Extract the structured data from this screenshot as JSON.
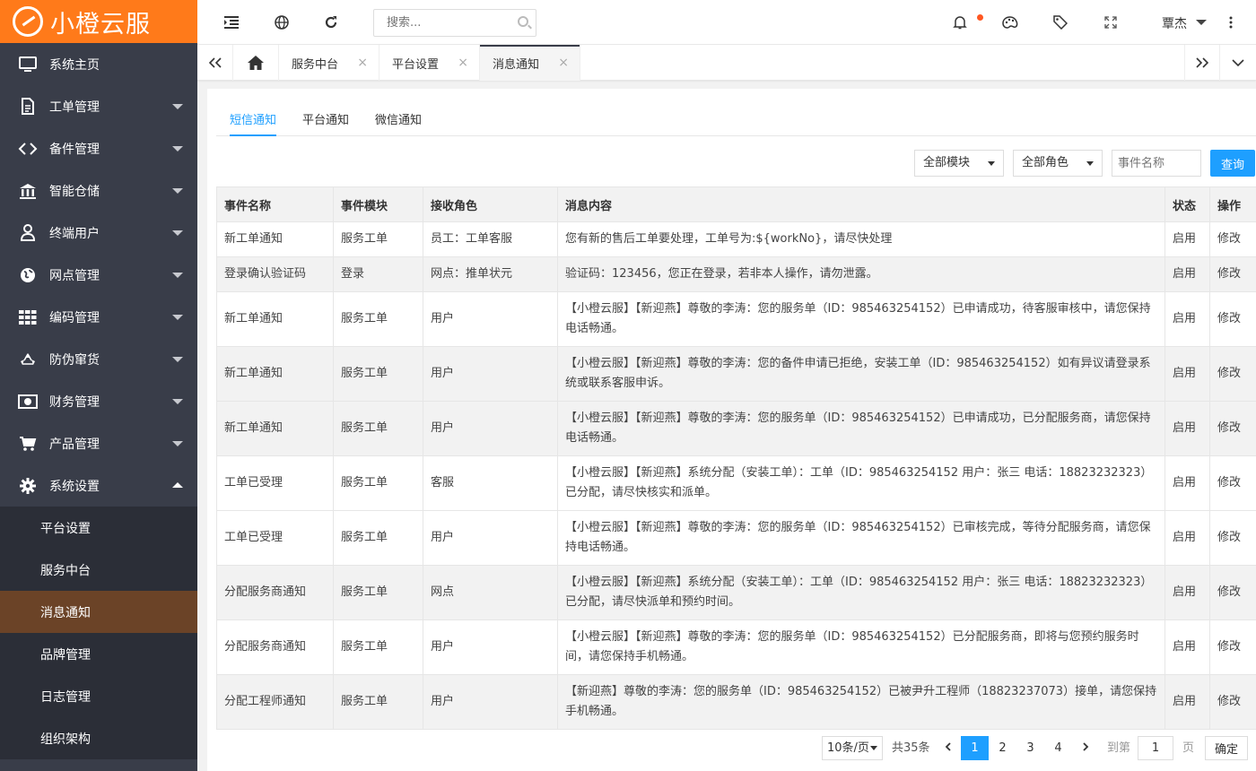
{
  "app": {
    "logo_text": "小橙云服"
  },
  "sidebar": {
    "items": [
      {
        "label": "系统主页",
        "icon": "monitor-icon"
      },
      {
        "label": "工单管理",
        "icon": "document-icon"
      },
      {
        "label": "备件管理",
        "icon": "link-icon"
      },
      {
        "label": "智能仓储",
        "icon": "warehouse-icon"
      },
      {
        "label": "终端用户",
        "icon": "user-icon"
      },
      {
        "label": "网点管理",
        "icon": "globe-icon"
      },
      {
        "label": "编码管理",
        "icon": "grid-icon"
      },
      {
        "label": "防伪窜货",
        "icon": "recycle-icon"
      },
      {
        "label": "财务管理",
        "icon": "money-icon"
      },
      {
        "label": "产品管理",
        "icon": "cart-icon"
      },
      {
        "label": "系统设置",
        "icon": "gear-icon"
      }
    ],
    "sub_items": [
      "平台设置",
      "服务中台",
      "消息通知",
      "品牌管理",
      "日志管理",
      "组织架构"
    ]
  },
  "topbar": {
    "search_placeholder": "搜索...",
    "user_name": "覃杰"
  },
  "tabs": {
    "items": [
      "服务中台",
      "平台设置",
      "消息通知"
    ],
    "close": "×"
  },
  "subtabs": [
    "短信通知",
    "平台通知",
    "微信通知"
  ],
  "filters": {
    "module": "全部模块",
    "role": "全部角色",
    "event_placeholder": "事件名称",
    "query_label": "查询"
  },
  "table": {
    "headers": [
      "事件名称",
      "事件模块",
      "接收角色",
      "消息内容",
      "状态",
      "操作"
    ],
    "rows": [
      {
        "name": "新工单通知",
        "module": "服务工单",
        "role": "员工：工单客服",
        "content": "您有新的售后工单要处理，工单号为:${workNo}，请尽快处理",
        "status": "启用",
        "action": "修改"
      },
      {
        "name": "登录确认验证码",
        "module": "登录",
        "role": "网点：推单状元",
        "content": "验证码：123456，您正在登录，若非本人操作，请勿泄露。",
        "status": "启用",
        "action": "修改"
      },
      {
        "name": "新工单通知",
        "module": "服务工单",
        "role": "用户",
        "content": "【小橙云服】【新迎燕】尊敬的李涛：您的服务单（ID：985463254152）已申请成功，待客服审核中，请您保持电话畅通。",
        "status": "启用",
        "action": "修改"
      },
      {
        "name": "新工单通知",
        "module": "服务工单",
        "role": "用户",
        "content": "【小橙云服】【新迎燕】尊敬的李涛：您的备件申请已拒绝，安装工单（ID：985463254152）如有异议请登录系统或联系客服申诉。",
        "status": "启用",
        "action": "修改"
      },
      {
        "name": "新工单通知",
        "module": "服务工单",
        "role": "用户",
        "content": "【小橙云服】【新迎燕】尊敬的李涛：您的服务单（ID：985463254152）已申请成功，已分配服务商，请您保持电话畅通。",
        "status": "启用",
        "action": "修改"
      },
      {
        "name": "工单已受理",
        "module": "服务工单",
        "role": "客服",
        "content": "【小橙云服】【新迎燕】系统分配（安装工单）：工单（ID：985463254152 用户：张三 电话：18823232323）已分配，请尽快核实和派单。",
        "status": "启用",
        "action": "修改"
      },
      {
        "name": "工单已受理",
        "module": "服务工单",
        "role": "用户",
        "content": "【小橙云服】【新迎燕】尊敬的李涛：您的服务单（ID：985463254152）已审核完成，等待分配服务商，请您保持电话畅通。",
        "status": "启用",
        "action": "修改"
      },
      {
        "name": "分配服务商通知",
        "module": "服务工单",
        "role": "网点",
        "content": "【小橙云服】【新迎燕】系统分配（安装工单）：工单（ID：985463254152 用户：张三 电话：18823232323）已分配，请尽快派单和预约时间。",
        "status": "启用",
        "action": "修改"
      },
      {
        "name": "分配服务商通知",
        "module": "服务工单",
        "role": "用户",
        "content": "【小橙云服】【新迎燕】尊敬的李涛：您的服务单（ID：985463254152）已分配服务商，即将与您预约服务时间，请您保持手机畅通。",
        "status": "启用",
        "action": "修改"
      },
      {
        "name": "分配工程师通知",
        "module": "服务工单",
        "role": "用户",
        "content": "【新迎燕】尊敬的李涛：您的服务单（ID：985463254152）已被尹升工程师（18823237073）接单，请您保持手机畅通。",
        "status": "启用",
        "action": "修改"
      }
    ]
  },
  "pagination": {
    "page_size": "10条/页",
    "total": "共35条",
    "pages": [
      "1",
      "2",
      "3",
      "4"
    ],
    "goto_label": "到第",
    "goto_value": "1",
    "page_unit": "页",
    "confirm_label": "确定"
  },
  "colors": {
    "logo_bg": "#ff7a1a",
    "sidebar_bg": "#393d49",
    "submenu_bg": "#2b2e37",
    "active_sub_bg": "#6b4327",
    "accent": "#1e9fff",
    "status_green": "#23a523",
    "notify_dot": "#ff5722"
  }
}
